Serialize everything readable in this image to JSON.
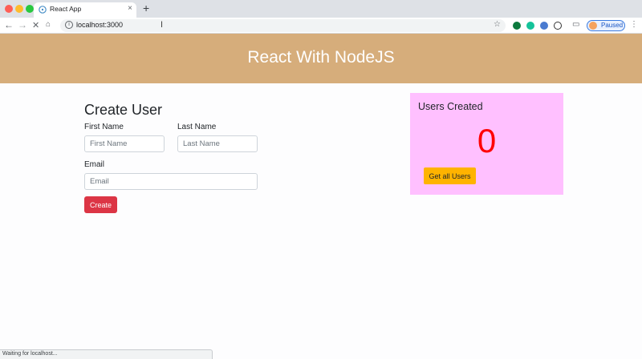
{
  "browser": {
    "tab_title": "React App",
    "tab_close": "×",
    "new_tab": "+",
    "url": "localhost:3000",
    "profile_label": "Paused",
    "status_text": "Waiting for localhost..."
  },
  "icons": {
    "back": "arrow-left-icon",
    "forward": "arrow-right-icon",
    "stop": "close-icon",
    "home": "home-icon",
    "info": "info-icon",
    "bookmark": "star-icon",
    "cast": "cast-icon",
    "menu": "more-vert-icon"
  },
  "header": {
    "title": "React With NodeJS"
  },
  "form": {
    "title": "Create User",
    "first_name_label": "First Name",
    "first_name_placeholder": "First Name",
    "last_name_label": "Last Name",
    "last_name_placeholder": "Last Name",
    "email_label": "Email",
    "email_placeholder": "Email",
    "submit_label": "Create"
  },
  "users_card": {
    "title": "Users Created",
    "count": "0",
    "button_label": "Get all Users"
  },
  "colors": {
    "header_bg": "#d6ad7b",
    "create_button": "#dc3545",
    "card_bg": "#ffc0ff",
    "count_text": "#ff0000",
    "get_users_button": "#ffb300"
  }
}
